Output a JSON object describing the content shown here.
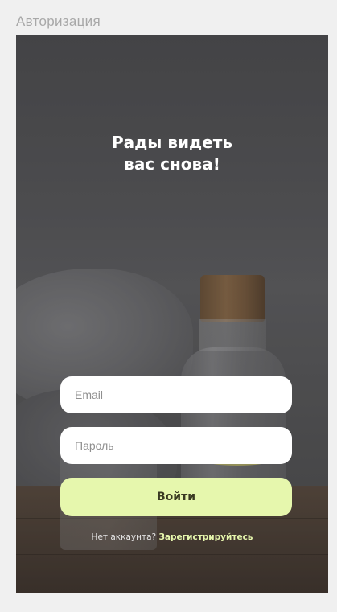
{
  "frame": {
    "label": "Авторизация"
  },
  "screen": {
    "title_line1": "Рады видеть",
    "title_line2": "вас снова!"
  },
  "form": {
    "email_placeholder": "Email",
    "password_placeholder": "Пароль",
    "submit_label": "Войти"
  },
  "signup": {
    "prompt": "Нет аккаунта?",
    "link_label": "Зарегистрируйтесь"
  },
  "colors": {
    "accent": "#e6f7ad",
    "field_background": "#ffffff",
    "title_text": "#ffffff"
  }
}
